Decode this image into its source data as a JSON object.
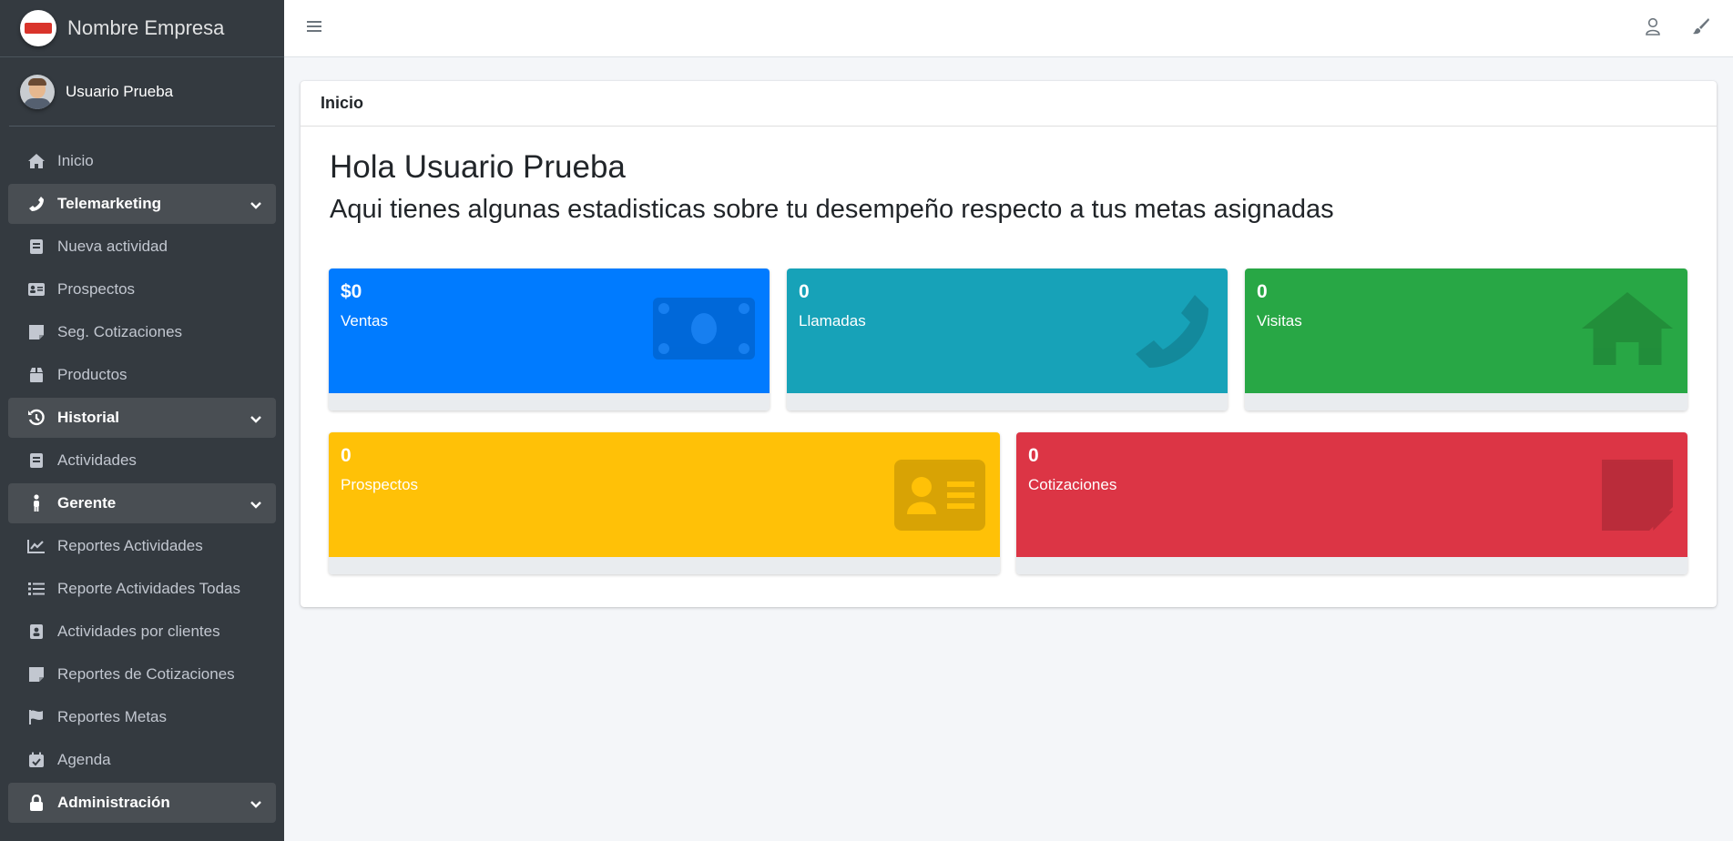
{
  "brand": {
    "name": "Nombre Empresa"
  },
  "user": {
    "name": "Usuario Prueba"
  },
  "sidebar": {
    "items": [
      {
        "label": "Inicio",
        "icon": "home-icon"
      },
      {
        "label": "Telemarketing",
        "icon": "phone-icon",
        "open": true
      },
      {
        "label": "Nueva actividad",
        "icon": "book-icon"
      },
      {
        "label": "Prospectos",
        "icon": "id-card-icon"
      },
      {
        "label": "Seg. Cotizaciones",
        "icon": "sticky-note-icon"
      },
      {
        "label": "Productos",
        "icon": "box-icon"
      },
      {
        "label": "Historial",
        "icon": "history-icon",
        "open": true
      },
      {
        "label": "Actividades",
        "icon": "book-icon"
      },
      {
        "label": "Gerente",
        "icon": "person-icon",
        "open": true
      },
      {
        "label": "Reportes Actividades",
        "icon": "line-chart-icon"
      },
      {
        "label": "Reporte Actividades Todas",
        "icon": "list-icon"
      },
      {
        "label": "Actividades por clientes",
        "icon": "address-book-icon"
      },
      {
        "label": "Reportes de Cotizaciones",
        "icon": "sticky-note-icon"
      },
      {
        "label": "Reportes Metas",
        "icon": "flag-icon"
      },
      {
        "label": "Agenda",
        "icon": "calendar-check-icon"
      },
      {
        "label": "Administración",
        "icon": "lock-icon",
        "open": true
      }
    ]
  },
  "page": {
    "card_title": "Inicio",
    "greeting": "Hola Usuario Prueba",
    "subtitle": "Aqui tienes algunas estadisticas sobre tu desempeño respecto a tus metas asignadas"
  },
  "stats": [
    {
      "value": "$0",
      "label": "Ventas",
      "color": "#007bff",
      "icon": "money-bill-icon"
    },
    {
      "value": "0",
      "label": "Llamadas",
      "color": "#17a2b8",
      "icon": "phone-icon"
    },
    {
      "value": "0",
      "label": "Visitas",
      "color": "#28a745",
      "icon": "home-icon"
    },
    {
      "value": "0",
      "label": "Prospectos",
      "color": "#ffc107",
      "icon": "id-card-icon"
    },
    {
      "value": "0",
      "label": "Cotizaciones",
      "color": "#dc3545",
      "icon": "sticky-note-icon"
    }
  ]
}
